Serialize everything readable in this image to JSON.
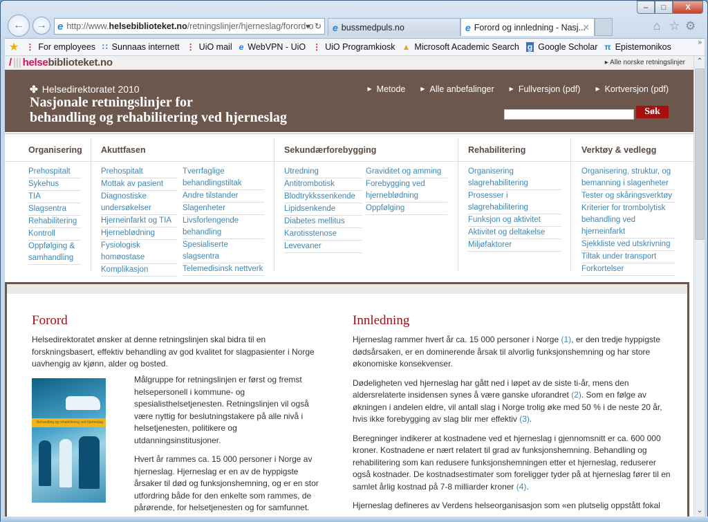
{
  "browser": {
    "address": {
      "prefix": "http://www.",
      "domain": "helsebiblioteket.no",
      "path": "/retningslinjer/hjerneslag/forord-o"
    },
    "tabs": [
      {
        "label": "bussmedpuls.no",
        "active": false
      },
      {
        "label": "Forord og innledning - Nasj...",
        "active": true
      }
    ],
    "window_controls": {
      "minimize": "–",
      "maximize": "□",
      "close": "X"
    },
    "toolbar_icons": [
      "home-icon",
      "favorites-star-icon",
      "gear-icon"
    ],
    "favorites": [
      {
        "label": "For employees",
        "icon": "uio-icon"
      },
      {
        "label": "Sunnaas internett",
        "icon": "sunnaas-icon"
      },
      {
        "label": "UiO mail",
        "icon": "uio-icon"
      },
      {
        "label": "WebVPN - UiO",
        "icon": "ie-page-icon"
      },
      {
        "label": "UiO Programkiosk",
        "icon": "uio-icon"
      },
      {
        "label": "Microsoft Academic Search",
        "icon": "mas-icon"
      },
      {
        "label": "Google Scholar",
        "icon": "scholar-icon"
      },
      {
        "label": "Epistemonikos",
        "icon": "epistemonikos-icon"
      }
    ],
    "favorites_more": "»"
  },
  "site": {
    "logo": {
      "helse": "helse",
      "rest": "biblioteket.no"
    },
    "top_link": "Alle norske retningslinjer",
    "header": {
      "org": "Helsedirektoratet",
      "year": "2010",
      "title_line1": "Nasjonale retningslinjer for",
      "title_line2": "behandling og rehabilitering ved hjerneslag",
      "nav": [
        "Metode",
        "Alle anbefalinger",
        "Fullversjon (pdf)",
        "Kortversjon (pdf)"
      ],
      "search_placeholder": "",
      "search_button": "Søk"
    },
    "menu": {
      "organisering": {
        "title": "Organisering",
        "items": [
          "Prehospitalt",
          "Sykehus",
          "TIA",
          "Slagsentra",
          "Rehabilitering",
          "Kontroll",
          "Oppfølging & samhandling"
        ]
      },
      "akuttfasen": {
        "title": "Akuttfasen",
        "col1": [
          "Prehospitalt",
          "Mottak av pasient",
          "Diagnostiske undersøkelser",
          "Hjerneinfarkt og TIA",
          "Hjerneblødning",
          "Fysiologisk homøostase",
          "Komplikasjon"
        ],
        "col2": [
          "Tverrfaglige behandlingstiltak",
          "Andre tilstander",
          "Slagenheter",
          "Livsforlengende behandling",
          "Spesialiserte slagsentra",
          "Telemedisinsk nettverk"
        ]
      },
      "sekundaer": {
        "title": "Sekundærforebygging",
        "col1": [
          "Utredning",
          "Antitrombotisk",
          "Blodtrykkssenkende",
          "Lipidsenkende",
          "Diabetes mellitus",
          "Karotisstenose",
          "Levevaner"
        ],
        "col2": [
          "Graviditet og amming",
          "Forebygging ved hjerneblødning",
          "Oppfølging"
        ]
      },
      "rehabilitering": {
        "title": "Rehabilitering",
        "items": [
          "Organisering slagrehabilitering",
          "Prosesser i slagrehabilitering",
          "Funksjon og aktivitet",
          "Aktivitet og deltakelse",
          "Miljøfaktorer"
        ]
      },
      "verktoy": {
        "title": "Verktøy & vedlegg",
        "items": [
          "Organisering, struktur, og bemanning i slagenheter",
          "Tester og skåringsverktøy",
          "Kriterier for trombolytisk behandling ved hjerneinfarkt",
          "Sjekkliste ved utskrivning",
          "Tiltak under transport",
          "Forkortelser"
        ]
      }
    },
    "forord": {
      "title": "Forord",
      "intro": "Helsedirektoratet ønsker at denne retningslinjen skal bidra til en forskningsbasert, effektiv behandling av god kvalitet for slagpasienter i Norge uavhengig av kjønn, alder og bosted.",
      "cover_strip": "Behandling og rehabilitering ved hjerneslag",
      "p1": "Målgruppe for retningslinjen er først og fremst helsepersonell i kommune- og spesialisthelsetjenesten. Retningslinjen vil også være nyttig for beslutningstakere på alle nivå i helsetjenesten, politikere og utdanningsinstitusjoner.",
      "p2": "Hvert år rammes ca. 15 000 personer i Norge av hjerneslag. Hjerneslag er en av de hyppigste årsaker til død og funksjonshemning, og er en stor utfordring både for den enkelte som rammes, de pårørende, for helsetjenesten og for samfunnet."
    },
    "innledning": {
      "title": "Innledning",
      "p1a": "Hjerneslag rammer hvert år ca. 15 000 personer i Norge ",
      "ref1": "(1)",
      "p1b": ", er den tredje hyppigste dødsårsaken, er en dominerende årsak til alvorlig funksjonshemning og har store økonomiske konsekvenser.",
      "p2a": "Dødeligheten ved hjerneslag har gått ned i løpet av de siste ti-år, mens den aldersrelaterte insidensen synes å være ganske uforandret ",
      "ref2": "(2)",
      "p2b": ". Som en følge av økningen i andelen eldre, vil antall slag i Norge trolig øke med 50 % i de neste 20 år, hvis ikke forebygging av slag blir mer effektiv ",
      "ref3": "(3)",
      "p2c": ".",
      "p3a": "Beregninger indikerer at kostnadene ved et hjerneslag i gjennomsnitt er ca. 600 000 kroner. Kostnadene er nært relatert til grad av funksjonshemning. Behandling og rehabilitering som kan redusere funksjonshemningen etter et hjerneslag, reduserer også kostnader. De kostnadsestimater som foreligger tyder på at hjerneslag fører til en samlet årlig kostnad på 7-8 milliarder kroner ",
      "ref4": "(4)",
      "p3b": ".",
      "p4": "Hjerneslag defineres av Verdens helseorganisasjon som «en plutselig oppstått fokal"
    }
  }
}
